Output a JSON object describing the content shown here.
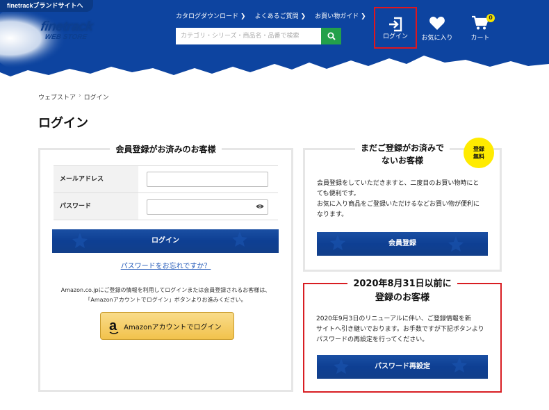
{
  "header": {
    "brand_link": "finetrackブランドサイトへ",
    "logo_main": "finetrack",
    "logo_sub": "WEB STORE",
    "top_links": [
      {
        "label": "カタログダウンロード",
        "arrow": "❯"
      },
      {
        "label": "よくあるご質問",
        "arrow": "❯"
      },
      {
        "label": "お買い物ガイド",
        "arrow": "❯"
      }
    ],
    "search_placeholder": "カテゴリ・シリーズ・商品名・品番で検索",
    "login_label": "ログイン",
    "favorites_label": "お気に入り",
    "cart_label": "カート",
    "cart_count": "0"
  },
  "breadcrumb": {
    "home": "ウェブストア",
    "separator": "›",
    "current": "ログイン"
  },
  "page_title": "ログイン",
  "member_section": {
    "title": "会員登録がお済みのお客様",
    "email_label": "メールアドレス",
    "password_label": "パスワード",
    "login_button": "ログイン",
    "forgot_link": "パスワードをお忘れですか？",
    "amazon_note_line1": "Amazon.co.jpにご登録の情報を利用してログインまたは会員登録されるお客様は、",
    "amazon_note_line2": "「Amazonアカウントでログイン」ボタンよりお進みください。",
    "amazon_logo": "a",
    "amazon_button": "Amazonアカウントでログイン"
  },
  "new_section": {
    "title_line1": "まだご登録がお済みで",
    "title_line2": "ないお客様",
    "badge_line1": "登録",
    "badge_line2": "無料",
    "desc_line1": "会員登録をしていただきますと、二度目のお買い物時にと",
    "desc_line2": "ても便利です。",
    "desc_line3": "お気に入り商品をご登録いただけるなどお買い物が便利に",
    "desc_line4": "なります。",
    "register_button": "会員登録"
  },
  "legacy_section": {
    "title_line1": "2020年8月31日以前に",
    "title_line2": "登録のお客様",
    "desc_line1": "2020年9月3日のリニューアルに伴い、ご登録情報を新",
    "desc_line2": "サイトへ引き継いでおります。お手数ですが下記ボタンより",
    "desc_line3": "パスワードの再設定を行ってください。",
    "reset_button": "パスワード再設定"
  },
  "colors": {
    "header_blue": "#0d3f8f",
    "button_blue": "#0e3f93",
    "search_green": "#23a04a",
    "highlight_red": "#d81d22",
    "badge_yellow": "#ffeb00"
  }
}
